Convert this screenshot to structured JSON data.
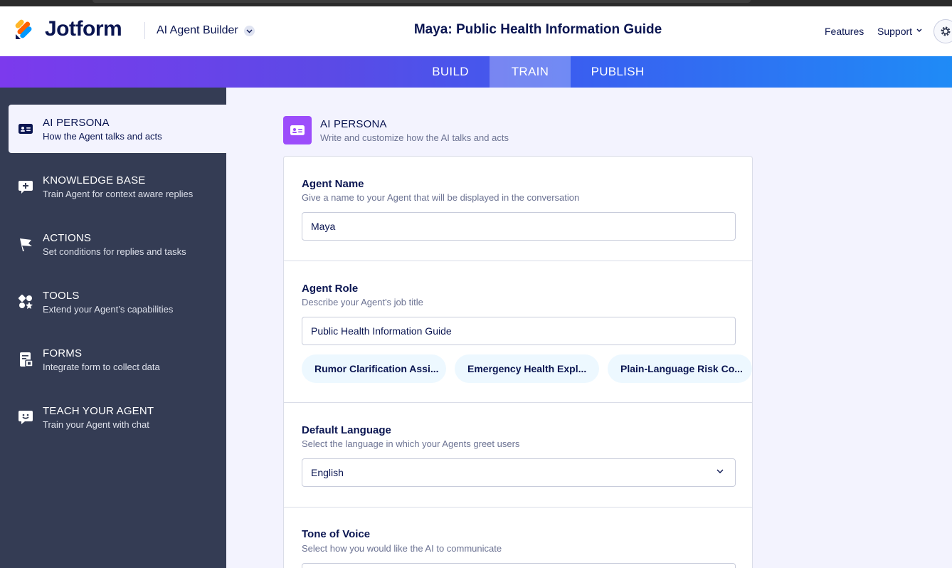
{
  "header": {
    "brand": "Jotform",
    "product": "AI Agent Builder",
    "title": "Maya: Public Health Information Guide",
    "nav": {
      "features": "Features",
      "support": "Support"
    }
  },
  "tabs": {
    "build": "BUILD",
    "train": "TRAIN",
    "publish": "PUBLISH",
    "active": "TRAIN"
  },
  "sidebar": {
    "items": [
      {
        "title": "AI PERSONA",
        "sub": "How the Agent talks and acts",
        "icon": "id-card-icon",
        "active": true
      },
      {
        "title": "KNOWLEDGE BASE",
        "sub": "Train Agent for context aware replies",
        "icon": "chat-plus-icon"
      },
      {
        "title": "ACTIONS",
        "sub": "Set conditions for replies and tasks",
        "icon": "flag-icon"
      },
      {
        "title": "TOOLS",
        "sub": "Extend your Agent’s capabilities",
        "icon": "shapes-icon"
      },
      {
        "title": "FORMS",
        "sub": "Integrate form to collect data",
        "icon": "form-icon"
      },
      {
        "title": "TEACH YOUR AGENT",
        "sub": "Train your Agent with chat",
        "icon": "smile-chat-icon"
      }
    ]
  },
  "section": {
    "title": "AI PERSONA",
    "sub": "Write and customize how the AI talks and acts"
  },
  "form": {
    "agent_name": {
      "label": "Agent Name",
      "desc": "Give a name to your Agent that will be displayed in the conversation",
      "value": "Maya"
    },
    "agent_role": {
      "label": "Agent Role",
      "desc": "Describe your Agent's job title",
      "value": "Public Health Information Guide",
      "suggestions": [
        "Rumor Clarification Assi...",
        "Emergency Health Expl...",
        "Plain-Language Risk Co..."
      ]
    },
    "language": {
      "label": "Default Language",
      "desc": "Select the language in which your Agents greet users",
      "value": "English"
    },
    "tone": {
      "label": "Tone of Voice",
      "desc": "Select how you would like the AI to communicate"
    }
  },
  "colors": {
    "accent": "#9c4dfb",
    "navy": "#0a1551",
    "sidebar": "#343c54"
  }
}
